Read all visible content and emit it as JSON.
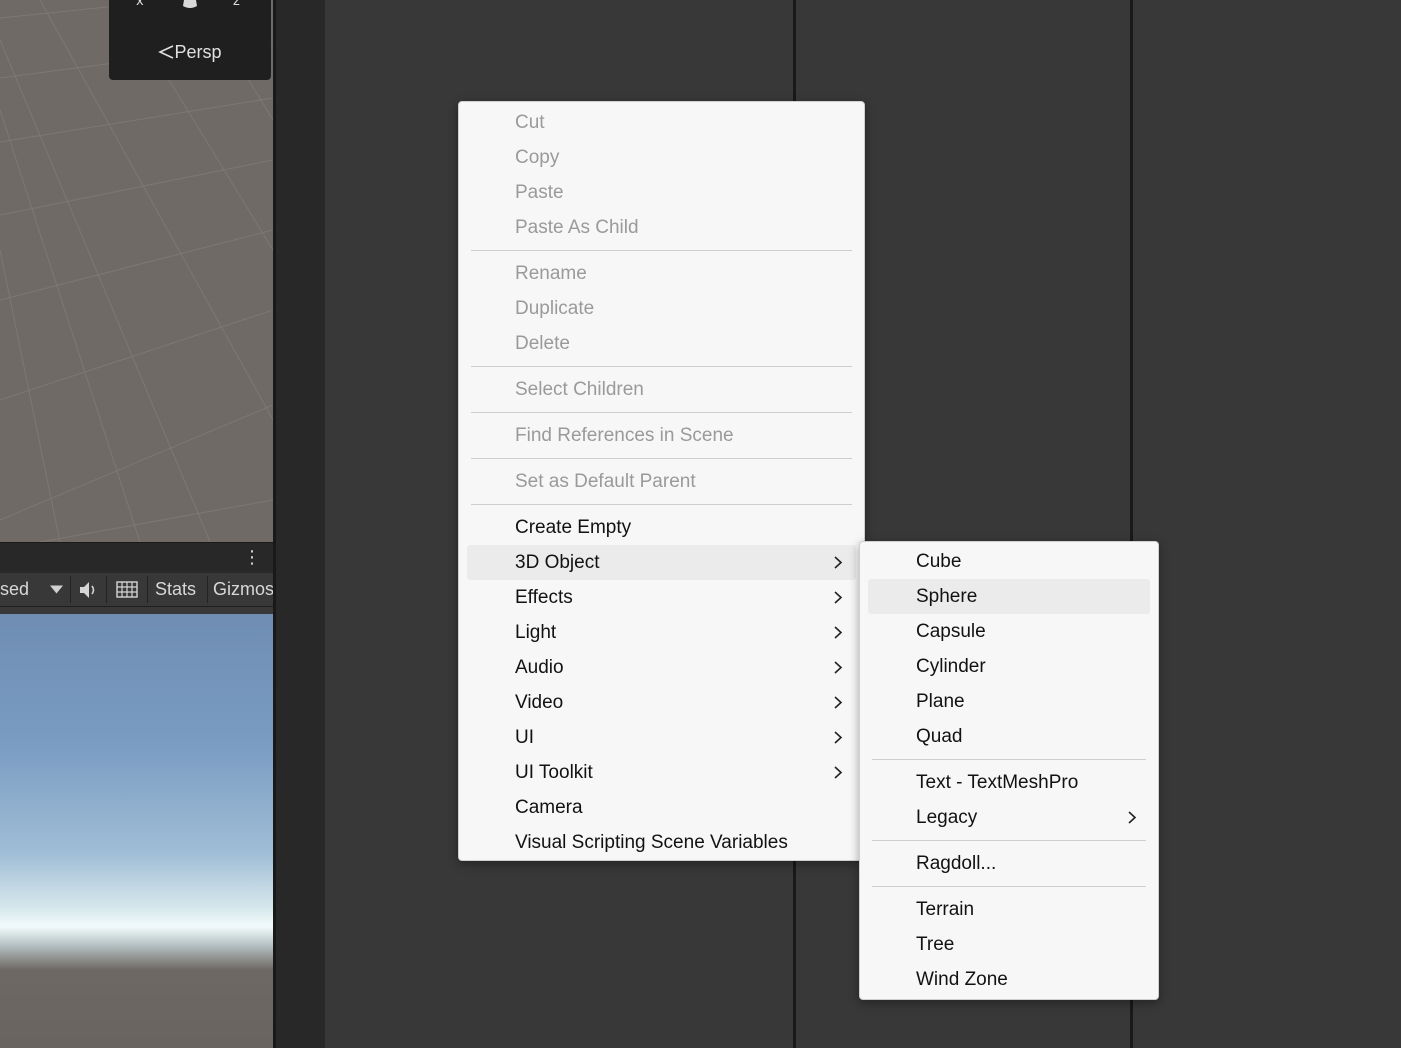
{
  "scene_view": {
    "axis_x_label": "x",
    "axis_z_label": "z",
    "projection_label": "Persp",
    "projection_icon": "chevron-left-icon"
  },
  "game_toolbar": {
    "aspect_dropdown_text": "sed",
    "dropdown_icon": "caret-down-icon",
    "audio_icon": "speaker-icon",
    "grid_icon": "keyboard-icon",
    "stats_label": "Stats",
    "gizmos_label": "Gizmos",
    "menu_icon": "kebab-menu-icon"
  },
  "context_menu": {
    "groups": [
      [
        {
          "label": "Cut",
          "enabled": false
        },
        {
          "label": "Copy",
          "enabled": false
        },
        {
          "label": "Paste",
          "enabled": false
        },
        {
          "label": "Paste As Child",
          "enabled": false
        }
      ],
      [
        {
          "label": "Rename",
          "enabled": false
        },
        {
          "label": "Duplicate",
          "enabled": false
        },
        {
          "label": "Delete",
          "enabled": false
        }
      ],
      [
        {
          "label": "Select Children",
          "enabled": false
        }
      ],
      [
        {
          "label": "Find References in Scene",
          "enabled": false
        }
      ],
      [
        {
          "label": "Set as Default Parent",
          "enabled": false
        }
      ],
      [
        {
          "label": "Create Empty",
          "enabled": true
        },
        {
          "label": "3D Object",
          "enabled": true,
          "submenu": true,
          "highlighted": true
        },
        {
          "label": "Effects",
          "enabled": true,
          "submenu": true
        },
        {
          "label": "Light",
          "enabled": true,
          "submenu": true
        },
        {
          "label": "Audio",
          "enabled": true,
          "submenu": true
        },
        {
          "label": "Video",
          "enabled": true,
          "submenu": true
        },
        {
          "label": "UI",
          "enabled": true,
          "submenu": true
        },
        {
          "label": "UI Toolkit",
          "enabled": true,
          "submenu": true
        },
        {
          "label": "Camera",
          "enabled": true
        },
        {
          "label": "Visual Scripting Scene Variables",
          "enabled": true
        }
      ]
    ]
  },
  "submenu_3d_object": {
    "groups": [
      [
        {
          "label": "Cube"
        },
        {
          "label": "Sphere",
          "highlighted": true
        },
        {
          "label": "Capsule"
        },
        {
          "label": "Cylinder"
        },
        {
          "label": "Plane"
        },
        {
          "label": "Quad"
        }
      ],
      [
        {
          "label": "Text - TextMeshPro"
        },
        {
          "label": "Legacy",
          "submenu": true
        }
      ],
      [
        {
          "label": "Ragdoll..."
        }
      ],
      [
        {
          "label": "Terrain"
        },
        {
          "label": "Tree"
        },
        {
          "label": "Wind Zone"
        }
      ]
    ]
  },
  "colors": {
    "editor_bg": "#383838",
    "menu_bg": "#f7f7f7",
    "menu_text": "#121212",
    "menu_disabled_text": "#9a9a9a",
    "menu_highlight": "#ebebeb"
  }
}
